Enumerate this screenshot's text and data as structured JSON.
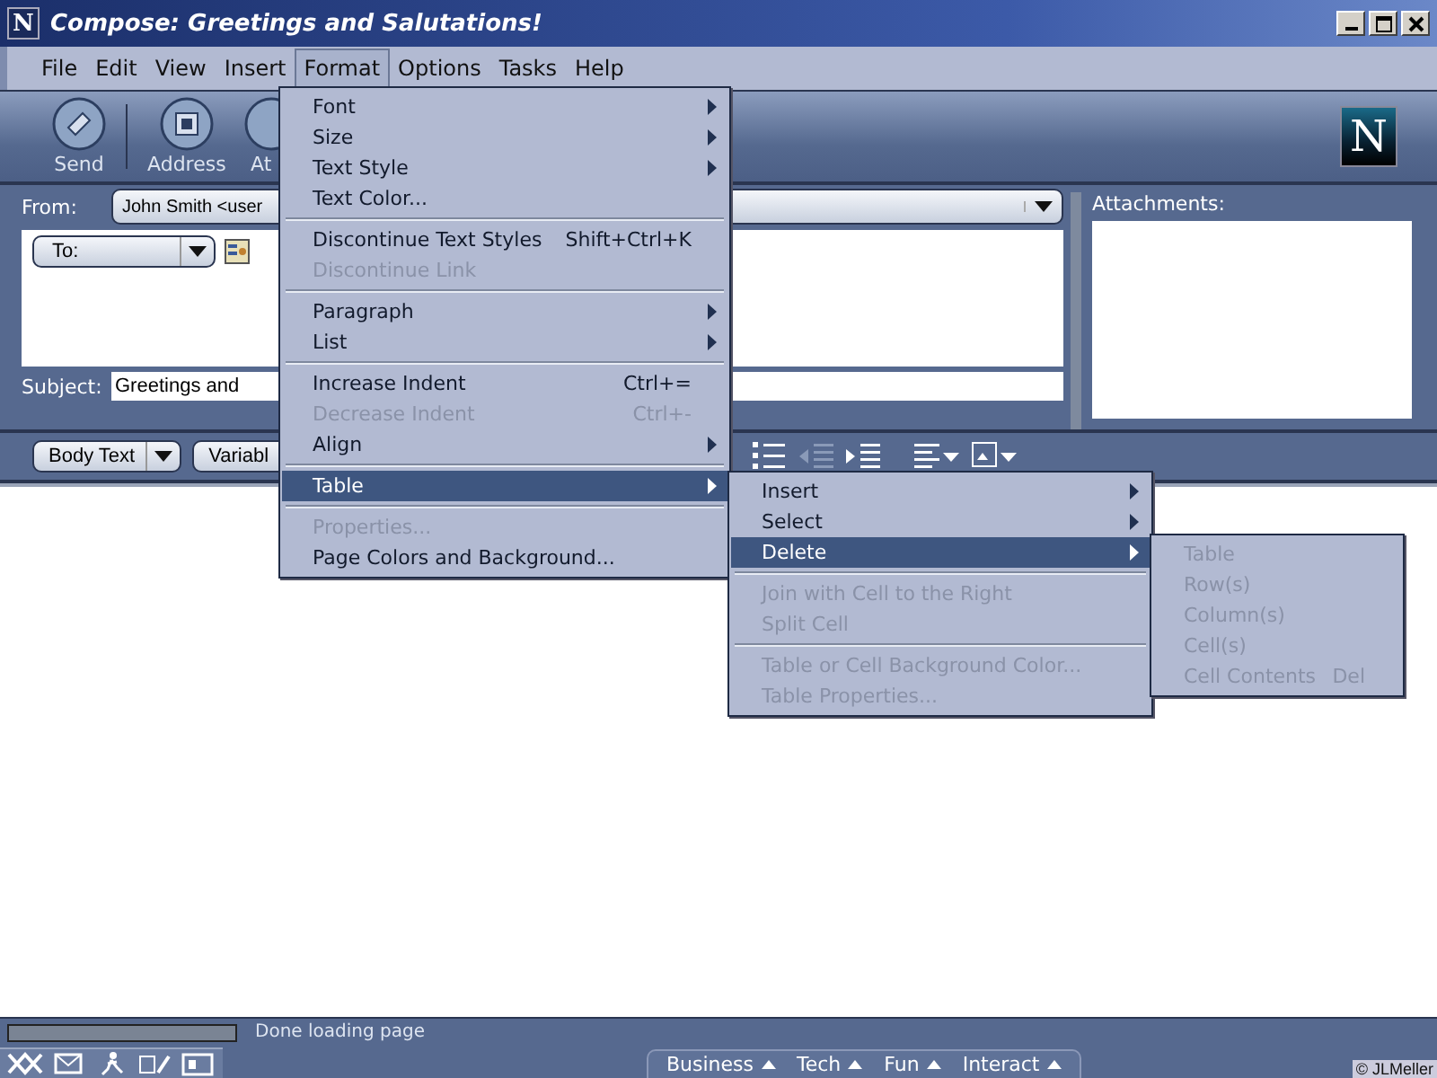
{
  "window": {
    "logo": "N",
    "title": "Compose: Greetings and Salutations!"
  },
  "brand_logo": "N",
  "menubar": [
    {
      "label": "File",
      "selected": false
    },
    {
      "label": "Edit",
      "selected": false
    },
    {
      "label": "View",
      "selected": false
    },
    {
      "label": "Insert",
      "selected": false
    },
    {
      "label": "Format",
      "selected": true
    },
    {
      "label": "Options",
      "selected": false
    },
    {
      "label": "Tasks",
      "selected": false
    },
    {
      "label": "Help",
      "selected": false
    }
  ],
  "toolbar": [
    {
      "label": "Send",
      "kind": "send"
    },
    {
      "label": "Address",
      "kind": "address"
    },
    {
      "label": "At",
      "kind": "attach"
    }
  ],
  "header": {
    "from_label": "From:",
    "from_value": "John Smith <user",
    "to_label": "To:",
    "subject_label": "Subject:",
    "subject_value": "Greetings and",
    "attachments_label": "Attachments:"
  },
  "format_bar": {
    "style": "Body Text",
    "font": "Variabl"
  },
  "format_menu": [
    {
      "kind": "item",
      "label": "Font",
      "submenu": true,
      "disabled": false,
      "selected": false
    },
    {
      "kind": "item",
      "label": "Size",
      "submenu": true,
      "disabled": false,
      "selected": false
    },
    {
      "kind": "item",
      "label": "Text Style",
      "submenu": true,
      "disabled": false,
      "selected": false
    },
    {
      "kind": "item",
      "label": "Text Color...",
      "submenu": false,
      "disabled": false,
      "selected": false
    },
    {
      "kind": "separator"
    },
    {
      "kind": "item",
      "label": "Discontinue Text Styles",
      "shortcut": "Shift+Ctrl+K",
      "submenu": false,
      "disabled": false,
      "selected": false
    },
    {
      "kind": "item",
      "label": "Discontinue Link",
      "submenu": false,
      "disabled": true,
      "selected": false
    },
    {
      "kind": "separator"
    },
    {
      "kind": "item",
      "label": "Paragraph",
      "submenu": true,
      "disabled": false,
      "selected": false
    },
    {
      "kind": "item",
      "label": "List",
      "submenu": true,
      "disabled": false,
      "selected": false
    },
    {
      "kind": "separator"
    },
    {
      "kind": "item",
      "label": "Increase Indent",
      "shortcut": "Ctrl+=",
      "submenu": false,
      "disabled": false,
      "selected": false
    },
    {
      "kind": "item",
      "label": "Decrease Indent",
      "shortcut": "Ctrl+-",
      "submenu": false,
      "disabled": true,
      "selected": false
    },
    {
      "kind": "item",
      "label": "Align",
      "submenu": true,
      "disabled": false,
      "selected": false
    },
    {
      "kind": "separator"
    },
    {
      "kind": "item",
      "label": "Table",
      "submenu": true,
      "disabled": false,
      "selected": true
    },
    {
      "kind": "separator"
    },
    {
      "kind": "item",
      "label": "Properties...",
      "submenu": false,
      "disabled": true,
      "selected": false
    },
    {
      "kind": "item",
      "label": "Page Colors and Background...",
      "submenu": false,
      "disabled": false,
      "selected": false
    }
  ],
  "table_menu": [
    {
      "kind": "item",
      "label": "Insert",
      "submenu": true,
      "disabled": false,
      "selected": false
    },
    {
      "kind": "item",
      "label": "Select",
      "submenu": true,
      "disabled": false,
      "selected": false
    },
    {
      "kind": "item",
      "label": "Delete",
      "submenu": true,
      "disabled": false,
      "selected": true
    },
    {
      "kind": "separator"
    },
    {
      "kind": "item",
      "label": "Join with Cell to the Right",
      "submenu": false,
      "disabled": true,
      "selected": false
    },
    {
      "kind": "item",
      "label": "Split Cell",
      "submenu": false,
      "disabled": true,
      "selected": false
    },
    {
      "kind": "separator"
    },
    {
      "kind": "item",
      "label": "Table or Cell Background Color...",
      "submenu": false,
      "disabled": true,
      "selected": false
    },
    {
      "kind": "item",
      "label": "Table Properties...",
      "submenu": false,
      "disabled": true,
      "selected": false
    }
  ],
  "delete_menu": [
    {
      "kind": "item",
      "label": "Table",
      "submenu": false,
      "disabled": true,
      "selected": false
    },
    {
      "kind": "item",
      "label": "Row(s)",
      "submenu": false,
      "disabled": true,
      "selected": false
    },
    {
      "kind": "item",
      "label": "Column(s)",
      "submenu": false,
      "disabled": true,
      "selected": false
    },
    {
      "kind": "item",
      "label": "Cell(s)",
      "submenu": false,
      "disabled": true,
      "selected": false
    },
    {
      "kind": "item",
      "label": "Cell Contents",
      "shortcut": "Del",
      "submenu": false,
      "disabled": true,
      "selected": false
    }
  ],
  "status_bar": {
    "progress": {
      "level": 0
    },
    "text": "Done loading page",
    "tabs": [
      "Business",
      "Tech",
      "Fun",
      "Interact"
    ],
    "credit": "© JLMeller"
  }
}
